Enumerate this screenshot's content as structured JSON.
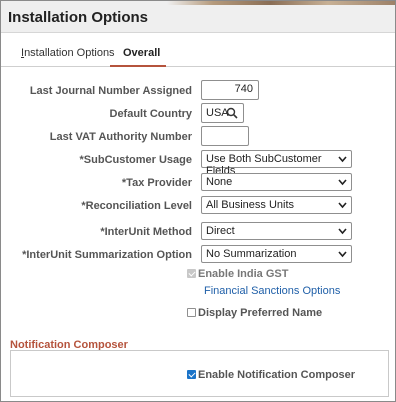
{
  "header": {
    "title": "Installation Options"
  },
  "tabs": [
    {
      "label_first": "I",
      "label_rest": "nstallation Options"
    },
    {
      "label": "Overall"
    }
  ],
  "form": {
    "last_journal": {
      "label": "Last Journal Number Assigned",
      "value": "740"
    },
    "default_country": {
      "label": "Default Country",
      "value": "USA"
    },
    "last_vat": {
      "label": "Last VAT Authority Number",
      "value": ""
    },
    "subcustomer_usage": {
      "label": "*SubCustomer Usage",
      "value": "Use Both SubCustomer Fields"
    },
    "tax_provider": {
      "label": "*Tax Provider",
      "value": "None"
    },
    "reconciliation_level": {
      "label": "*Reconciliation Level",
      "value": "All Business Units"
    },
    "interunit_method": {
      "label": "*InterUnit Method",
      "value": "Direct"
    },
    "interunit_summarization": {
      "label": "*InterUnit Summarization Option",
      "value": "No Summarization"
    },
    "enable_india_gst": {
      "label": "Enable India GST",
      "checked": true,
      "disabled": true
    },
    "financial_sanctions_link": "Financial Sanctions Options",
    "display_preferred_name": {
      "label": "Display Preferred Name",
      "checked": false
    }
  },
  "notification": {
    "title": "Notification Composer",
    "enable": {
      "label": "Enable Notification Composer",
      "checked": true
    }
  },
  "icons": {
    "search": "search-icon",
    "dropdown": "chevron-down-icon"
  },
  "colors": {
    "accent": "#b5533c",
    "link": "#1f5fa8",
    "checkbox": "#1a73c8"
  }
}
